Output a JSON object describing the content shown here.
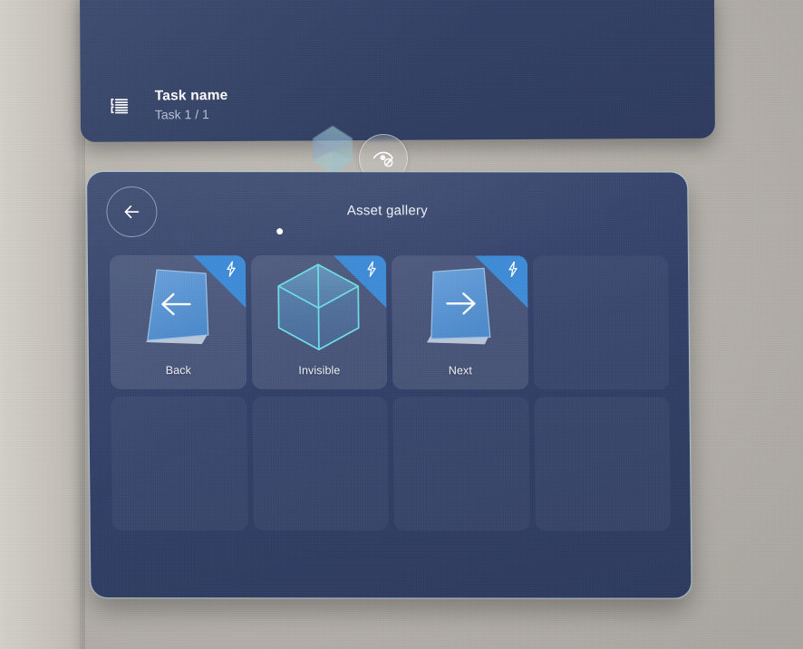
{
  "task_panel": {
    "icon": "task-list-icon",
    "title": "Task name",
    "subtitle": "Task 1 / 1"
  },
  "handles": {
    "gem_icon": "gem-crystal-icon",
    "hide_button_icon": "eye-off-icon"
  },
  "gallery": {
    "back_icon": "arrow-left-icon",
    "title": "Asset gallery",
    "page_dots": [
      {
        "active": true
      }
    ],
    "assets": [
      {
        "label": "Back",
        "thumb_icon": "card-arrow-left-icon",
        "badge_icon": "lightning-bolt-icon",
        "empty": false
      },
      {
        "label": "Invisible",
        "thumb_icon": "wireframe-cube-icon",
        "badge_icon": "lightning-bolt-icon",
        "empty": false
      },
      {
        "label": "Next",
        "thumb_icon": "card-arrow-right-icon",
        "badge_icon": "lightning-bolt-icon",
        "empty": false
      },
      {
        "label": "",
        "thumb_icon": "",
        "badge_icon": "",
        "empty": true
      },
      {
        "label": "",
        "thumb_icon": "",
        "badge_icon": "",
        "empty": true
      },
      {
        "label": "",
        "thumb_icon": "",
        "badge_icon": "",
        "empty": true
      },
      {
        "label": "",
        "thumb_icon": "",
        "badge_icon": "",
        "empty": true
      },
      {
        "label": "",
        "thumb_icon": "",
        "badge_icon": "",
        "empty": true
      }
    ]
  },
  "colors": {
    "panel_blue": "#33416a",
    "accent_blue": "#3f8cd8",
    "card_face": "#5694d6",
    "wireframe_cyan": "#6fe0e8",
    "wall": "#bdb8b2",
    "text_primary": "#ffffff",
    "text_secondary": "#b9c2d4"
  }
}
